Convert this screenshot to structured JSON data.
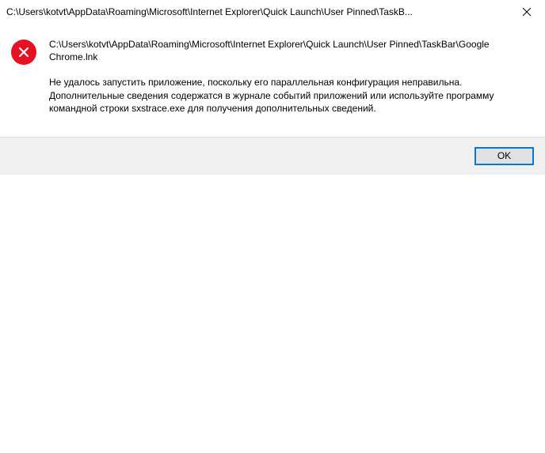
{
  "titlebar": {
    "title": "C:\\Users\\kotvt\\AppData\\Roaming\\Microsoft\\Internet Explorer\\Quick Launch\\User Pinned\\TaskB..."
  },
  "icon": {
    "name": "error-icon"
  },
  "body": {
    "path": "C:\\Users\\kotvt\\AppData\\Roaming\\Microsoft\\Internet Explorer\\Quick Launch\\User Pinned\\TaskBar\\Google Chrome.lnk",
    "message": "Не удалось запустить приложение, поскольку его параллельная конфигурация неправильна. Дополнительные сведения содержатся в журнале событий приложений или используйте программу командной строки sxstrace.exe для получения дополнительных сведений."
  },
  "buttons": {
    "ok": "OK"
  }
}
